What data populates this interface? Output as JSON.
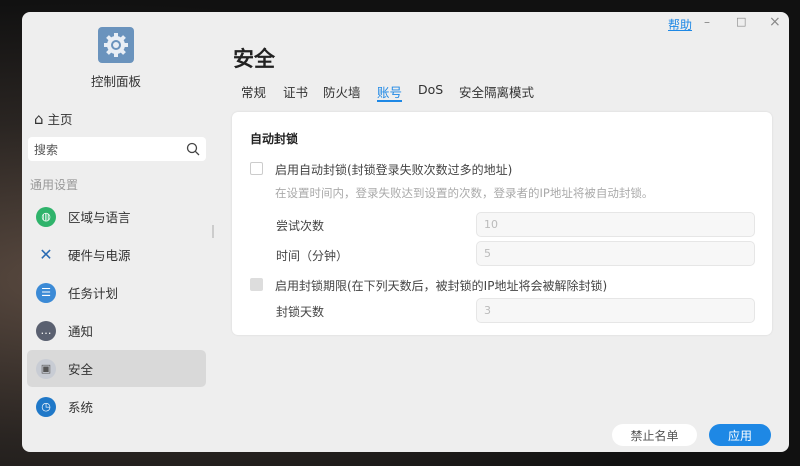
{
  "window": {
    "help": "帮助",
    "minimize": "–",
    "maximize": "□",
    "close": "×"
  },
  "sidebar": {
    "app_title": "控制面板",
    "home": "主页",
    "search_placeholder": "搜索",
    "section": "通用设置",
    "items": [
      {
        "label": "区域与语言",
        "icon": "globe-icon"
      },
      {
        "label": "硬件与电源",
        "icon": "tools-icon"
      },
      {
        "label": "任务计划",
        "icon": "task-icon"
      },
      {
        "label": "通知",
        "icon": "chat-icon"
      },
      {
        "label": "安全",
        "icon": "lock-icon"
      },
      {
        "label": "系统",
        "icon": "system-icon"
      }
    ],
    "selected": "安全"
  },
  "main": {
    "title": "安全",
    "tabs": [
      "常规",
      "证书",
      "防火墙",
      "账号",
      "DoS",
      "安全隔离模式"
    ],
    "active_tab": "账号",
    "section_title": "自动封锁",
    "enable_auto_block": {
      "label": "启用自动封锁(封锁登录失败次数过多的地址)",
      "checked": false
    },
    "description": "在设置时间内，登录失败达到设置的次数，登录者的IP地址将被自动封锁。",
    "attempts": {
      "label": "尝试次数",
      "value": "10"
    },
    "time": {
      "label": "时间（分钟）",
      "value": "5"
    },
    "enable_expiry": {
      "label": "启用封锁期限(在下列天数后，被封锁的IP地址将会被解除封锁)",
      "checked": false
    },
    "block_days": {
      "label": "封锁天数",
      "value": "3"
    }
  },
  "footer": {
    "blocklist": "禁止名单",
    "apply": "应用"
  },
  "colors": {
    "accent": "#1e88e5",
    "window_bg": "#eeeeee"
  }
}
